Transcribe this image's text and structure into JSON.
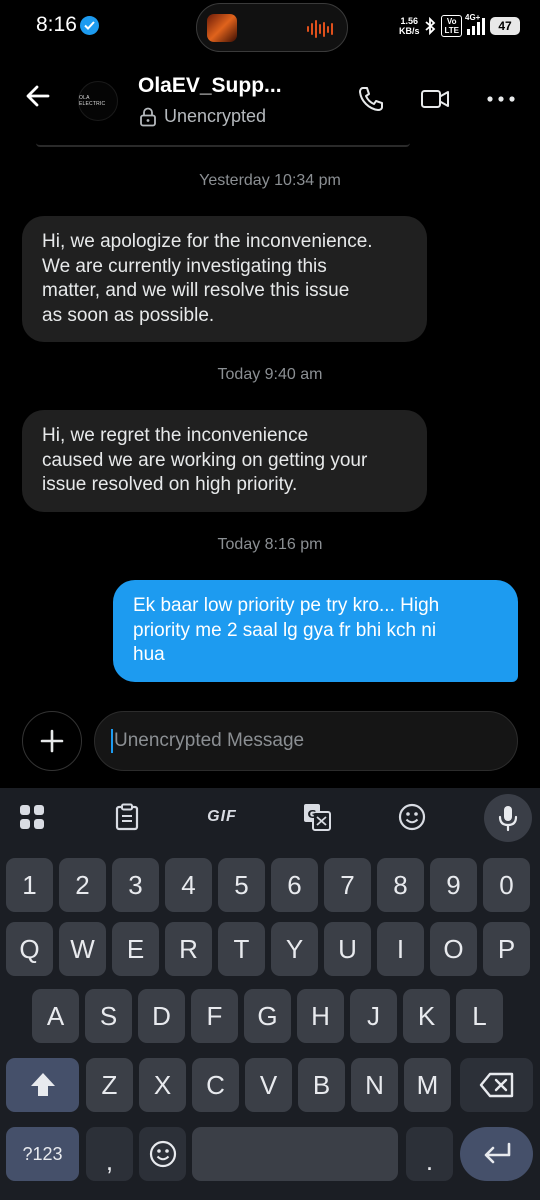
{
  "status_bar": {
    "time": "8:16",
    "net_speed_value": "1.56",
    "net_speed_unit": "KB/s",
    "volte_top": "Vo",
    "volte_bottom": "LTE",
    "network": "4G+",
    "battery": "47"
  },
  "header": {
    "contact_name": "OlaEV_Supp...",
    "encryption_status": "Unencrypted",
    "avatar_logo": "OLA ELECTRIC",
    "icons": [
      "back-arrow-icon",
      "phone-icon",
      "video-camera-icon",
      "more-icon"
    ]
  },
  "messages": [
    {
      "type": "timestamp",
      "text": "Yesterday 10:34 pm"
    },
    {
      "type": "incoming",
      "lines": [
        "Hi, we apologize for the inconvenience.",
        "We are currently investigating this",
        "matter, and we will resolve this issue",
        "as soon as possible."
      ]
    },
    {
      "type": "timestamp",
      "text": "Today 9:40 am"
    },
    {
      "type": "incoming",
      "lines": [
        "Hi, we regret the inconvenience",
        "caused we are working on getting your",
        "issue resolved on high priority."
      ]
    },
    {
      "type": "timestamp",
      "text": "Today 8:16 pm"
    },
    {
      "type": "outgoing",
      "lines": [
        "Ek baar low priority pe try kro... High",
        "priority me 2 saal lg gya fr bhi kch ni",
        "hua"
      ]
    }
  ],
  "compose": {
    "placeholder": "Unencrypted Message"
  },
  "keyboard": {
    "toolbar": {
      "gif_label": "GIF"
    },
    "number_row": [
      "1",
      "2",
      "3",
      "4",
      "5",
      "6",
      "7",
      "8",
      "9",
      "0"
    ],
    "row1": [
      "Q",
      "W",
      "E",
      "R",
      "T",
      "Y",
      "U",
      "I",
      "O",
      "P"
    ],
    "row2": [
      "A",
      "S",
      "D",
      "F",
      "G",
      "H",
      "J",
      "K",
      "L"
    ],
    "row3": [
      "Z",
      "X",
      "C",
      "V",
      "B",
      "N",
      "M"
    ],
    "symbols_key": "?123",
    "comma_key": ",",
    "period_key": "."
  },
  "colors": {
    "accent": "#1d9bf0",
    "incoming_bubble": "#202020",
    "keyboard_bg": "#1b1e24",
    "key_bg": "#3b3f47"
  }
}
